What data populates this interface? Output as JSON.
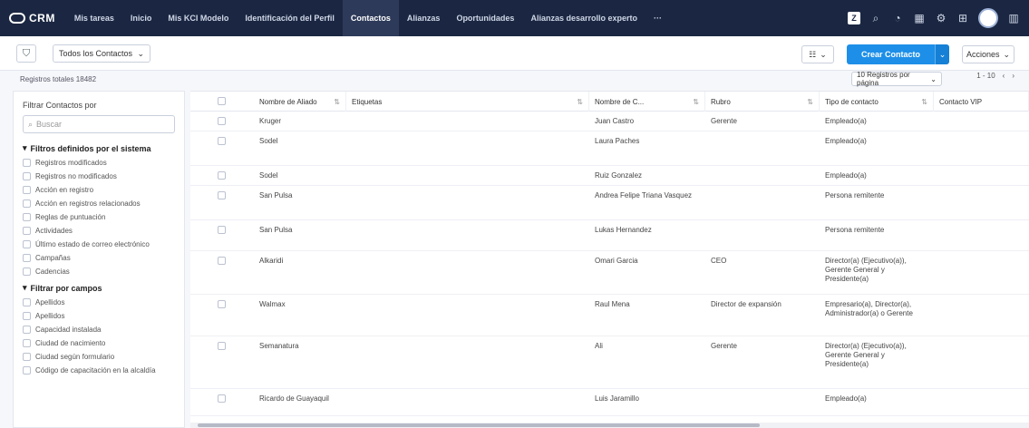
{
  "app": {
    "logo_text": "CRM"
  },
  "nav": {
    "tabs": [
      {
        "label": "Mis tareas",
        "active": false
      },
      {
        "label": "Inicio",
        "active": false
      },
      {
        "label": "Mis KCI Modelo",
        "active": false
      },
      {
        "label": "Identificación del Perfil",
        "active": false
      },
      {
        "label": "Contactos",
        "active": true
      },
      {
        "label": "Alianzas",
        "active": false
      },
      {
        "label": "Oportunidades",
        "active": false
      },
      {
        "label": "Alianzas desarrollo experto",
        "active": false
      }
    ],
    "more_label": "···",
    "right_icons": [
      "apps-icon",
      "search-icon",
      "bell-icon",
      "calendar-icon",
      "settings-icon",
      "grid-icon"
    ]
  },
  "toolbar": {
    "view_label": "Todos los Contactos",
    "kanban_label": "☷",
    "create_label": "Crear Contacto",
    "actions_label": "Acciones"
  },
  "infobar": {
    "total_text": "Registros totales 18482",
    "per_page_label": "10 Registros por página",
    "pager_text": "1 - 10"
  },
  "sidebar": {
    "title": "Filtrar Contactos por",
    "search_placeholder": "Buscar",
    "system_section": "Filtros definidos por el sistema",
    "system_filters": [
      "Registros modificados",
      "Registros no modificados",
      "Acción en registro",
      "Acción en registros relacionados",
      "Reglas de puntuación",
      "Actividades",
      "Último estado de correo electrónico",
      "Campañas",
      "Cadencias"
    ],
    "fields_section": "Filtrar por campos",
    "field_filters": [
      "Apellidos",
      "Apellidos",
      "Capacidad instalada",
      "Ciudad de nacimiento",
      "Ciudad según formulario",
      "Código de capacitación en la alcaldía"
    ]
  },
  "table": {
    "columns": [
      "Nombre de Aliado",
      "Etiquetas",
      "Nombre de C...",
      "Rubro",
      "Tipo de contacto",
      "Contacto VIP"
    ],
    "rows": [
      {
        "aliado": "Kruger",
        "etiquetas": "",
        "contacto": "Juan Castro",
        "rubro": "Gerente",
        "tipo": "Empleado(a)"
      },
      {
        "aliado": "Sodel",
        "etiquetas": "",
        "contacto": "Laura Paches",
        "rubro": "",
        "tipo": "Empleado(a)"
      },
      {
        "aliado": "Sodel",
        "etiquetas": "",
        "contacto": "Ruiz Gonzalez",
        "rubro": "",
        "tipo": "Empleado(a)"
      },
      {
        "aliado": "San Pulsa",
        "etiquetas": "",
        "contacto": "Andrea Felipe Triana Vasquez",
        "rubro": "",
        "tipo": "Persona remitente"
      },
      {
        "aliado": "San Pulsa",
        "etiquetas": "",
        "contacto": "Lukas Hernandez",
        "rubro": "",
        "tipo": "Persona remitente"
      },
      {
        "aliado": "Alkaridi",
        "etiquetas": "",
        "contacto": "Omari Garcia",
        "rubro": "CEO",
        "tipo": "Director(a) (Ejecutivo(a)), Gerente General y Presidente(a)"
      },
      {
        "aliado": "Walmax",
        "etiquetas": "",
        "contacto": "Raul Mena",
        "rubro": "Director de expansión",
        "tipo": "Empresario(a), Director(a), Administrador(a) o Gerente"
      },
      {
        "aliado": "Semanatura",
        "etiquetas": "",
        "contacto": "Ali",
        "rubro": "Gerente",
        "tipo": "Director(a) (Ejecutivo(a)), Gerente General y Presidente(a)"
      },
      {
        "aliado": "Ricardo de Guayaquil",
        "etiquetas": "",
        "contacto": "Luis Jaramillo",
        "rubro": "",
        "tipo": "Empleado(a)"
      }
    ]
  }
}
